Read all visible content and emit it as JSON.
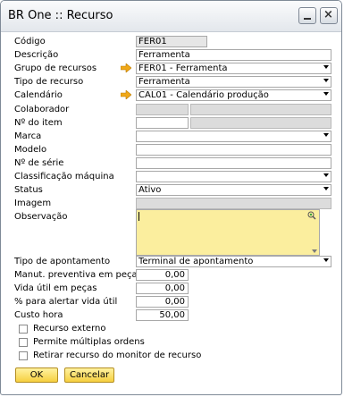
{
  "window": {
    "title": "BR One :: Recurso"
  },
  "form": {
    "codigo": {
      "label": "Código",
      "value": "FER01"
    },
    "descricao": {
      "label": "Descrição",
      "value": "Ferramenta"
    },
    "grupo": {
      "label": "Grupo de recursos",
      "value": "FER01 - Ferramenta"
    },
    "tipo": {
      "label": "Tipo de recurso",
      "value": "Ferramenta"
    },
    "calendario": {
      "label": "Calendário",
      "value": "CAL01 - Calendário produção"
    },
    "colaborador": {
      "label": "Colaborador",
      "value": ""
    },
    "item": {
      "label": "Nº do item",
      "value": ""
    },
    "marca": {
      "label": "Marca",
      "value": ""
    },
    "modelo": {
      "label": "Modelo",
      "value": ""
    },
    "serie": {
      "label": "Nº de série",
      "value": ""
    },
    "classificacao": {
      "label": "Classificação máquina",
      "value": ""
    },
    "status": {
      "label": "Status",
      "value": "Ativo"
    },
    "imagem": {
      "label": "Imagem",
      "value": ""
    },
    "observacao": {
      "label": "Observação",
      "value": ""
    },
    "apontamento": {
      "label": "Tipo de apontamento",
      "value": "Terminal de apontamento"
    },
    "manut": {
      "label": "Manut. preventiva em peças",
      "value": "0,00"
    },
    "vida": {
      "label": "Vida útil em peças",
      "value": "0,00"
    },
    "alerta": {
      "label": "% para alertar vida útil",
      "value": "0,00"
    },
    "custo": {
      "label": "Custo hora",
      "value": "50,00"
    }
  },
  "checkboxes": {
    "externo": "Recurso externo",
    "multiplas": "Permite múltiplas ordens",
    "retirar": "Retirar recurso do monitor de recurso"
  },
  "buttons": {
    "ok": "OK",
    "cancel": "Cancelar"
  },
  "colors": {
    "memo_bg": "#fbee9e",
    "button_gold": "#f6cf3f",
    "arrow_orange": "#f0a818"
  },
  "icons": [
    "minimize-icon",
    "close-icon",
    "link-arrow-icon",
    "dropdown-arrow-icon",
    "memo-edit-icon"
  ]
}
